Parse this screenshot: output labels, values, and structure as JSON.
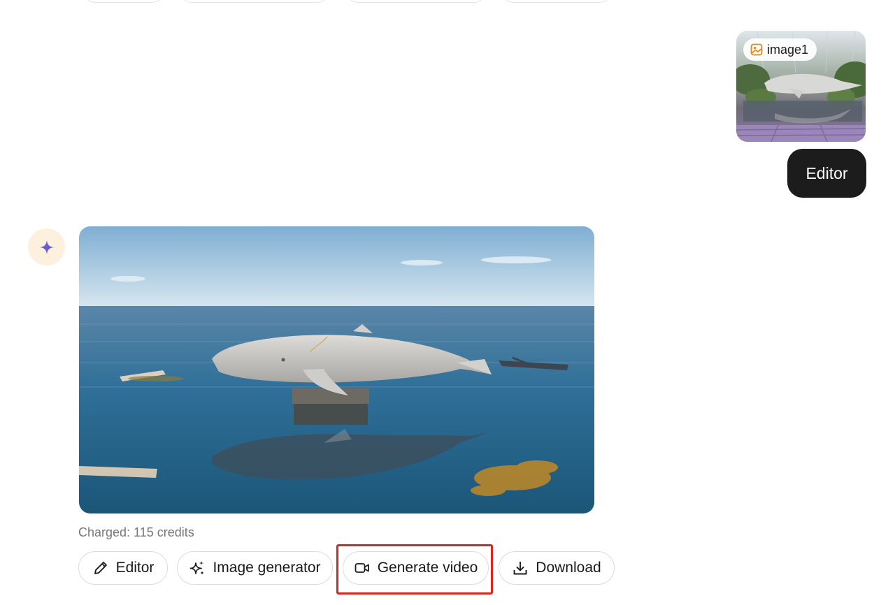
{
  "user_message": {
    "attachment_label": "image1",
    "text": "Editor"
  },
  "assistant": {
    "credits_text": "Charged: 115 credits",
    "actions": {
      "editor": "Editor",
      "image_generator": "Image generator",
      "generate_video": "Generate video",
      "download": "Download"
    }
  },
  "icons": {
    "avatar": "sparkle-icon",
    "attachment": "image-icon",
    "editor": "pencil-icon",
    "image_generator": "sparkles-icon",
    "generate_video": "video-camera-icon",
    "download": "download-icon"
  },
  "colors": {
    "user_bubble": "#1c1c1c",
    "avatar_bg": "#fdf0dc",
    "sparkle": "#6b5cd6",
    "attachment_icon": "#e08a1e",
    "highlight": "#e0241b"
  }
}
